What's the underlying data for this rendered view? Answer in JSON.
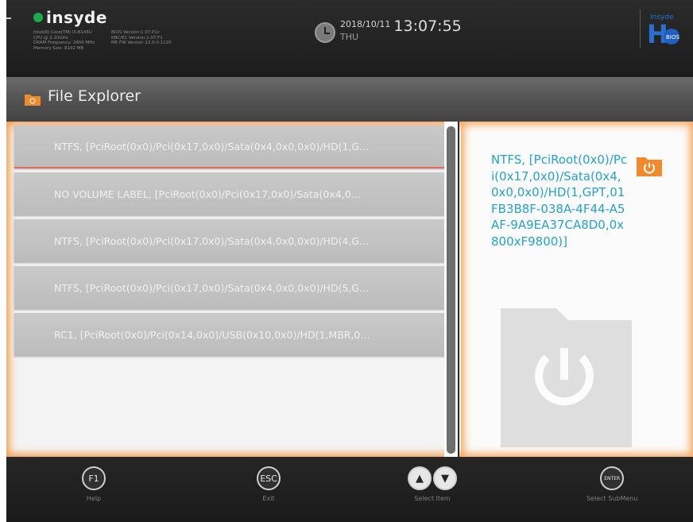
{
  "header": {
    "brand": "insyde",
    "info_left": "Intel(R) Core(TM) i5-8145U CPU @ 2.10GHz\nDRAM Frequency: 2400 MHz\nMemory Size: 8192 MB",
    "info_right": "BIOS Version:1.07.P1c\nKBC/EC Version:1.07.F1\nME FW Version:12.0.0.1120",
    "date": "2018/10/11",
    "day": "THU",
    "time": "13:07:55",
    "h2_label": "BIOS"
  },
  "page": {
    "title": "File Explorer"
  },
  "items": [
    {
      "label": "NTFS, [PciRoot(0x0)/Pci(0x17,0x0)/Sata(0x4,0x0,0x0)/HD(1,G..."
    },
    {
      "label": "NO VOLUME LABEL, [PciRoot(0x0)/Pci(0x17,0x0)/Sata(0x4,0..."
    },
    {
      "label": "NTFS, [PciRoot(0x0)/Pci(0x17,0x0)/Sata(0x4,0x0,0x0)/HD(4,G..."
    },
    {
      "label": "NTFS, [PciRoot(0x0)/Pci(0x17,0x0)/Sata(0x4,0x0,0x0)/HD(5,G..."
    },
    {
      "label": "RC1, [PciRoot(0x0)/Pci(0x14,0x0)/USB(0x10,0x0)/HD(1,MBR,0..."
    }
  ],
  "detail": {
    "text": "NTFS, [PciRoot(0x0)/Pci(0x17,0x0)/Sata(0x4,0x0,0x0)/HD(1,GPT,01FB3B8F-038A-4F44-A5AF-9A9EA37CA8D0,0x800xF9800)]"
  },
  "footer": {
    "keys": [
      {
        "key": "F1",
        "label": "Help"
      },
      {
        "key": "ESC",
        "label": "Exit"
      },
      {
        "key": "↑↓",
        "label": "Select Item"
      },
      {
        "key": "ENTER",
        "label": "Select SubMenu"
      }
    ]
  },
  "colors": {
    "accent_orange": "#f29d4f",
    "detail_text": "#2aa0c6",
    "selected_underline": "#e36a5d"
  }
}
